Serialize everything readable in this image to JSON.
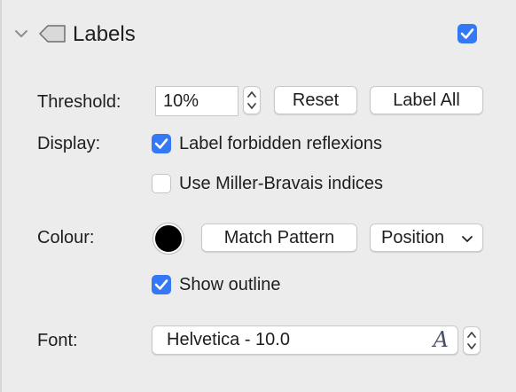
{
  "section": {
    "title": "Labels",
    "enabled": true,
    "icons": {
      "disclosure": "chevron-down-icon",
      "tag": "tag-icon"
    }
  },
  "threshold": {
    "label": "Threshold:",
    "value": "10%",
    "reset_label": "Reset",
    "label_all_label": "Label All"
  },
  "display": {
    "label": "Display:",
    "forbidden": {
      "label": "Label forbidden reflexions",
      "checked": true
    },
    "miller_bravais": {
      "label": "Use Miller-Bravais indices",
      "checked": false
    }
  },
  "colour": {
    "label": "Colour:",
    "swatch_color": "#000000",
    "match_pattern_label": "Match Pattern",
    "position_value": "Position",
    "show_outline": {
      "label": "Show outline",
      "checked": true
    }
  },
  "font": {
    "label": "Font:",
    "value": "Helvetica - 10.0",
    "picker_glyph": "A"
  },
  "colors": {
    "accent": "#3478f6",
    "background": "#ececec"
  }
}
